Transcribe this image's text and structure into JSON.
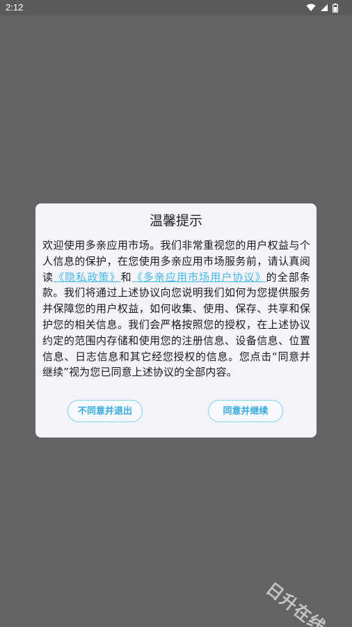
{
  "status_bar": {
    "time": "2:12",
    "icons": [
      "wifi-icon",
      "signal-icon",
      "battery-icon"
    ]
  },
  "dialog": {
    "title": "温馨提示",
    "body_part1": "欢迎使用多亲应用市场。我们非常重视您的用户权益与个人信息的保护，在您使用多亲应用市场服务前，请认真阅读",
    "privacy_link": "《隐私政策》",
    "conjunction": "和",
    "user_agreement_link": "《多亲应用市场用户协议》",
    "body_part2": "的全部条款。我们将通过上述协议向您说明我们如何为您提供服务并保障您的用户权益，如何收集、使用、保存、共享和保护您的相关信息。我们会严格按照您的授权，在上述协议约定的范围内存储和使用您的注册信息、设备信息、位置信息、日志信息和其它经您授权的信息。您点击“同意并继续”视为您已同意上述协议的全部内容。",
    "decline_button": "不同意并退出",
    "agree_button": "同意并继续"
  },
  "watermark": "日升在线",
  "colors": {
    "overlay": "#646467",
    "dialog_bg": "#f3f4f9",
    "link": "#46b8e8",
    "button_accent": "#36a9e0"
  }
}
